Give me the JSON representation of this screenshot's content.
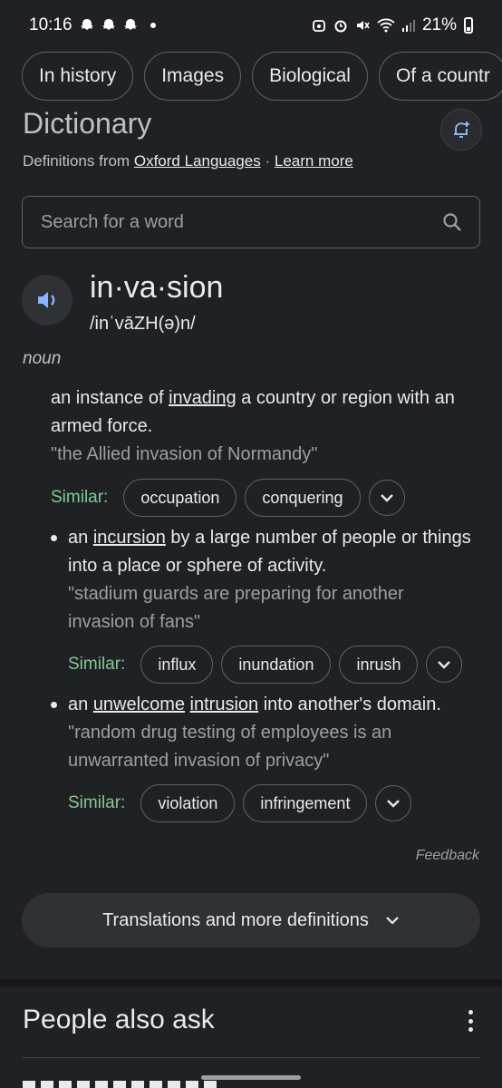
{
  "status_bar": {
    "time": "10:16",
    "battery": "21%"
  },
  "filter_chips": [
    "In history",
    "Images",
    "Biological",
    "Of a countr"
  ],
  "dictionary": {
    "title": "Dictionary",
    "source_prefix": "Definitions from",
    "source_link": "Oxford Languages",
    "separator": "·",
    "learn_more": "Learn more",
    "search_placeholder": "Search for a word",
    "word": "in·va·sion",
    "phonetic": "/inˈvāZH(ə)n/",
    "part_of_speech": "noun",
    "similar_label": "Similar:",
    "definitions": [
      {
        "pre": "an instance of ",
        "link1": "invading",
        "post": " a country or region with an armed force.",
        "example": "\"the Allied invasion of Normandy\"",
        "synonyms": [
          "occupation",
          "conquering"
        ]
      },
      {
        "pre": "an ",
        "link1": "incursion",
        "post": " by a large number of people or things into a place or sphere of activity.",
        "example": "\"stadium guards are preparing for another invasion of fans\"",
        "synonyms": [
          "influx",
          "inundation",
          "inrush"
        ]
      },
      {
        "pre": "an ",
        "link1": "unwelcome",
        "mid": " ",
        "link2": "intrusion",
        "post": " into another's domain.",
        "example": "\"random drug testing of employees is an unwarranted invasion of privacy\"",
        "synonyms": [
          "violation",
          "infringement"
        ]
      }
    ],
    "feedback": "Feedback",
    "more_button": "Translations and more definitions"
  },
  "people_also_ask": {
    "title": "People also ask"
  },
  "colors": {
    "background": "#202124",
    "accent_green": "#81c995",
    "speaker_blue": "#8ab4f8"
  },
  "icons": [
    "snapchat-ghost-icon",
    "notification-add-icon",
    "search-icon",
    "speaker-icon",
    "chevron-down-icon",
    "more-vert-icon"
  ]
}
